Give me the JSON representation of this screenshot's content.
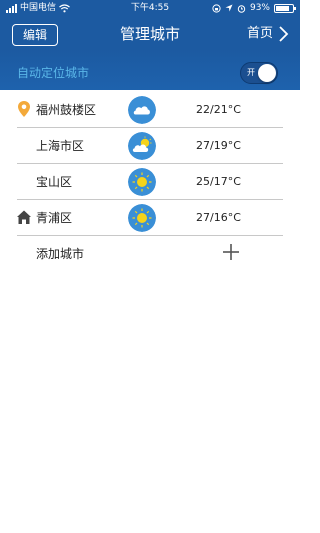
{
  "status_bar": {
    "carrier": "中国电信",
    "time": "下午4:55",
    "battery": "93%",
    "battery_level": 0.93
  },
  "navbar": {
    "edit_label": "编辑",
    "title": "管理城市",
    "home_label": "首页"
  },
  "auto_locate": {
    "label": "自动定位城市",
    "toggle_text": "开",
    "enabled": true
  },
  "cities": [
    {
      "name": "福州鼓楼区",
      "temp": "22/21°C",
      "weather_icon": "cloudy-icon",
      "lead_icon": "location-pin-icon"
    },
    {
      "name": "上海市区",
      "temp": "27/19°C",
      "weather_icon": "partly-cloudy-icon",
      "lead_icon": ""
    },
    {
      "name": "宝山区",
      "temp": "25/17°C",
      "weather_icon": "sunny-icon",
      "lead_icon": ""
    },
    {
      "name": "青浦区",
      "temp": "27/16°C",
      "weather_icon": "sunny-icon",
      "lead_icon": "home-icon"
    }
  ],
  "add_city": {
    "label": "添加城市"
  },
  "colors": {
    "header": "#1c5aa1",
    "accent_text": "#5ab6e8",
    "weather_circle": "#3a8fd6",
    "sun": "#f5d31a"
  }
}
